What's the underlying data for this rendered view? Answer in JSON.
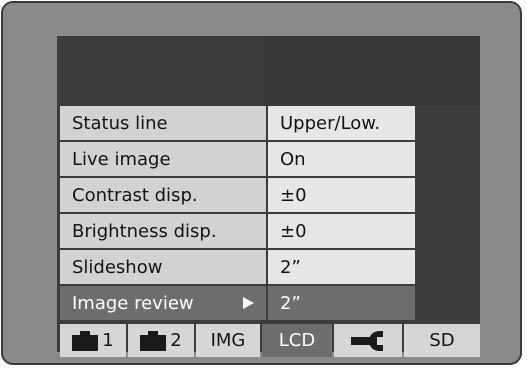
{
  "menu": {
    "items": [
      {
        "label": "Status line",
        "value": "Upper/Low.",
        "selected": false
      },
      {
        "label": "Live image",
        "value": "On",
        "selected": false
      },
      {
        "label": "Contrast disp.",
        "value": "±0",
        "selected": false
      },
      {
        "label": "Brightness disp.",
        "value": "±0",
        "selected": false
      },
      {
        "label": "Slideshow",
        "value": "2”",
        "selected": false
      },
      {
        "label": "Image review",
        "value": "2”",
        "selected": true
      }
    ]
  },
  "tabs": [
    {
      "icon": "camera-icon",
      "label": "1",
      "active": false
    },
    {
      "icon": "camera-icon",
      "label": "2",
      "active": false
    },
    {
      "icon": null,
      "label": "IMG",
      "active": false
    },
    {
      "icon": null,
      "label": "LCD",
      "active": true
    },
    {
      "icon": "wrench-icon",
      "label": "",
      "active": false
    },
    {
      "icon": null,
      "label": "SD",
      "active": false
    }
  ]
}
